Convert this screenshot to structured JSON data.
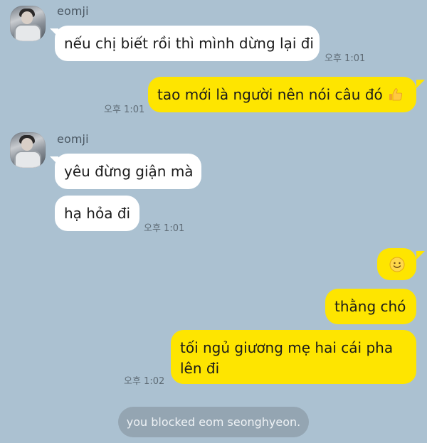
{
  "messages": [
    {
      "sender": "eomji",
      "text": "nếu chị biết rồi thì mình dừng lại đi",
      "time": "오후 1:01"
    },
    {
      "text": "tao mới là người nên nói câu đó",
      "emoji": "thumbs-up-icon",
      "time": "오후 1:01"
    },
    {
      "sender": "eomji",
      "text": "yêu đừng giận mà"
    },
    {
      "text": "hạ hỏa đi",
      "time": "오후 1:01"
    },
    {
      "emoji": "smiling-face-icon"
    },
    {
      "text": "thằng chó"
    },
    {
      "text": "tối ngủ giương mẹ hai cái pha lên đi",
      "time": "오후 1:02"
    }
  ],
  "system_notice": "you blocked eom seonghyeon.",
  "colors": {
    "background": "#abc1d1",
    "incoming_bubble": "#ffffff",
    "outgoing_bubble": "#fee500",
    "timestamp": "#5e6b75"
  }
}
